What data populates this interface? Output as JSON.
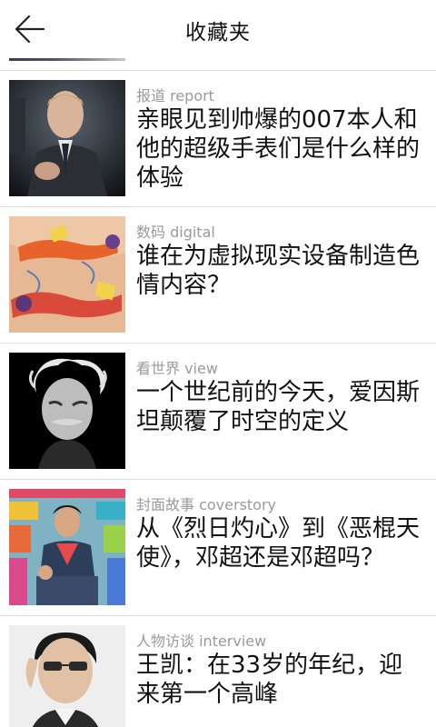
{
  "header": {
    "title": "收藏夹"
  },
  "items": [
    {
      "category": "报道 report",
      "title": "亲眼见到帅爆的007本人和他的超级手表们是什么样的体验"
    },
    {
      "category": "数码 digital",
      "title": "谁在为虚拟现实设备制造色情内容？"
    },
    {
      "category": "看世界 view",
      "title": "一个世纪前的今天，爱因斯坦颠覆了时空的定义"
    },
    {
      "category": "封面故事 coverstory",
      "title": "从《烈日灼心》到《恶棍天使》，邓超还是邓超吗？"
    },
    {
      "category": "人物访谈 interview",
      "title": "王凯：在33岁的年纪，迎来第一个高峰"
    }
  ]
}
